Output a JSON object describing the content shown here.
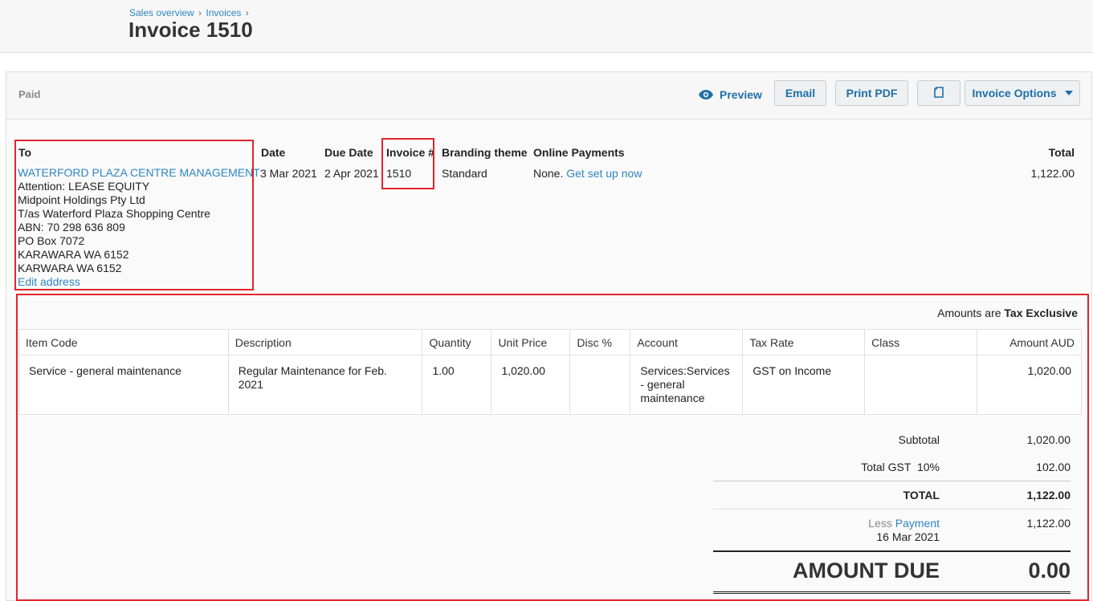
{
  "breadcrumb": {
    "item1": "Sales overview",
    "item2": "Invoices",
    "sep": "›"
  },
  "title": "Invoice 1510",
  "status": "Paid",
  "toolbar": {
    "preview": "Preview",
    "email": "Email",
    "print_pdf": "Print PDF",
    "invoice_options": "Invoice Options"
  },
  "details": {
    "to_label": "To",
    "date_label": "Date",
    "due_date_label": "Due Date",
    "invoice_no_label": "Invoice #",
    "branding_label": "Branding theme",
    "online_payments_label": "Online Payments",
    "total_label": "Total",
    "date": "3 Mar 2021",
    "due_date": "2 Apr 2021",
    "invoice_no": "1510",
    "branding": "Standard",
    "online_payments_text": "None.",
    "online_payments_link": "Get set up now",
    "total": "1,122.00"
  },
  "contact": {
    "name": "WATERFORD PLAZA CENTRE MANAGEMENT",
    "lines": [
      "Attention: LEASE EQUITY",
      "Midpoint Holdings Pty Ltd",
      "T/as Waterford Plaza Shopping Centre",
      "ABN: 70 298 636 809",
      "PO Box 7072",
      "KARAWARA WA 6152",
      "KARWARA WA 6152"
    ],
    "edit_address": "Edit address"
  },
  "amounts_are": {
    "prefix": "Amounts are",
    "value": "Tax Exclusive"
  },
  "table": {
    "columns": [
      "Item Code",
      "Description",
      "Quantity",
      "Unit Price",
      "Disc %",
      "Account",
      "Tax Rate",
      "Class",
      "Amount AUD"
    ],
    "rows": [
      {
        "item_code": "Service - general maintenance",
        "description": "Regular Maintenance for Feb. 2021",
        "quantity": "1.00",
        "unit_price": "1,020.00",
        "disc": "",
        "account": "Services:Services - general maintenance",
        "tax_rate": "GST on Income",
        "class": "",
        "amount": "1,020.00"
      }
    ]
  },
  "totals": {
    "subtotal_label": "Subtotal",
    "subtotal": "1,020.00",
    "gst_label": "Total GST  10%",
    "gst": "102.00",
    "total_label": "TOTAL",
    "total": "1,122.00",
    "less_label": "Less",
    "payment_link": "Payment",
    "payment_date": "16 Mar 2021",
    "payment_amount": "1,122.00",
    "amount_due_label": "AMOUNT DUE",
    "amount_due": "0.00"
  },
  "colors": {
    "link": "#2f86c2",
    "highlight": "#e0262c",
    "button_text": "#1f6fa8"
  }
}
